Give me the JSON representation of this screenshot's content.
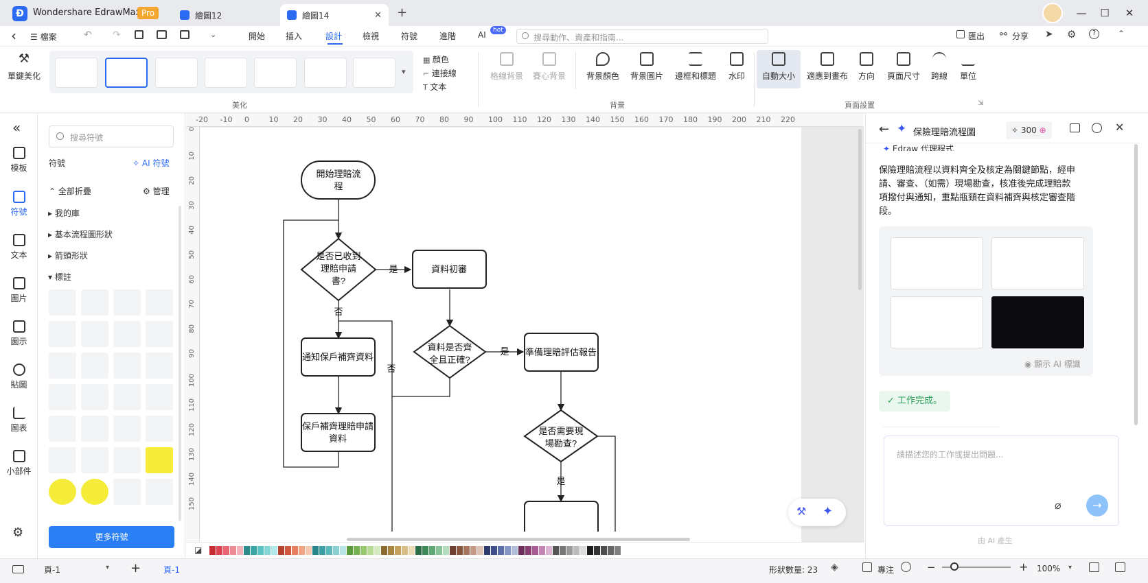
{
  "titlebar": {
    "app_name": "Wondershare EdrawMax",
    "badge": "Pro",
    "tabs": [
      {
        "label": "繪圖12"
      },
      {
        "label": "繪圖14"
      }
    ],
    "new_tab": "+",
    "window_controls": {
      "minimize": "—",
      "maximize": "☐",
      "close": "✕"
    }
  },
  "menubar": {
    "back": "‹",
    "file": "☰ 檔案",
    "items": [
      "開始",
      "插入",
      "設計",
      "檢視",
      "符號",
      "進階",
      "AI"
    ],
    "active_index": 2,
    "ai_badge": "hot",
    "search_placeholder": "搜尋動作、資產和指南...",
    "export": "匯出",
    "share": "分享"
  },
  "ribbon": {
    "beautify": "單鍵美化",
    "beautify_group": "美化",
    "style_options": [
      "顏色",
      "連接線",
      "文本"
    ],
    "background_buttons": [
      "格線背景",
      "賽心背景",
      "背景顏色",
      "背景圖片",
      "邊框和標題",
      "水印"
    ],
    "background_group": "背景",
    "page_buttons": [
      "自動大小",
      "適應到畫布",
      "方向",
      "頁面尺寸",
      "跨線",
      "單位"
    ],
    "page_group": "頁面設置"
  },
  "rail": {
    "collapse": "«",
    "items": [
      "模板",
      "符號",
      "文本",
      "圖片",
      "圖示",
      "貼圖",
      "圖表",
      "小部件"
    ],
    "active_index": 1
  },
  "symbols": {
    "search_placeholder": "搜尋符號",
    "title": "符號",
    "ai_symbols": "AI 符號",
    "collapse_all": "全部折疊",
    "manage": "管理",
    "tree": [
      "我的庫",
      "基本流程圖形狀",
      "箭頭形狀",
      "標註"
    ],
    "more_button": "更多符號"
  },
  "ruler": {
    "top": [
      "-20",
      "-10",
      "0",
      "10",
      "20",
      "30",
      "40",
      "50",
      "60",
      "70",
      "80",
      "90",
      "100",
      "110",
      "120",
      "130",
      "140",
      "150",
      "160",
      "170",
      "180",
      "190",
      "200",
      "210",
      "220"
    ],
    "left": [
      "0",
      "10",
      "20",
      "30",
      "40",
      "50",
      "60",
      "70",
      "80",
      "90",
      "100",
      "110",
      "120",
      "130",
      "140",
      "150"
    ]
  },
  "flowchart": {
    "start": [
      "開始理賠流",
      "程"
    ],
    "decision1": [
      "是否已收到",
      "理賠申請",
      "書?"
    ],
    "review": "資料初審",
    "notify": "通知保戶補齊資料",
    "resubmit": [
      "保戶補齊理賠申請",
      "資料"
    ],
    "decision2": [
      "資料是否齊",
      "全且正確?"
    ],
    "prepare": "準備理賠評估報告",
    "decision3": [
      "是否需要現",
      "場勘查?"
    ],
    "yes": "是",
    "no": "否"
  },
  "ai_panel": {
    "title": "保險理賠流程圖",
    "credits": "300",
    "agent_label": "Edraw 代理程式",
    "summary": "保險理賠流程以資料齊全及核定為關鍵節點，經申請、審查、（如需）現場勘查，核准後完成理賠款項撥付與通知，重點瓶頸在資料補齊與核定審查階段。",
    "show_ai_label": "顯示 AI 標識",
    "status": "工作完成。",
    "input_placeholder": "請描述您的工作或提出問題...",
    "footer": "由 AI 產生"
  },
  "statusbar": {
    "page_select": "頁-1",
    "add_page": "+",
    "active_page": "頁-1",
    "shape_count": "形狀數量: 23",
    "focus": "專注",
    "zoom": "100%"
  },
  "palette": [
    "#c62d33",
    "#d94450",
    "#e86773",
    "#ee8c95",
    "#f3b2b9",
    "#2e8b8b",
    "#3aa6a6",
    "#5cc2c2",
    "#85d6d6",
    "#b3e8e8",
    "#b3412e",
    "#d05a3f",
    "#e57f5d",
    "#f0a483",
    "#f6c8b0",
    "#27868a",
    "#3b9fa3",
    "#5db8bb",
    "#8ad0d2",
    "#b9e5e6",
    "#5a9a3a",
    "#76b24f",
    "#97c86e",
    "#b8dc96",
    "#d6ecc0",
    "#8a6a2e",
    "#a8843f",
    "#c3a05b",
    "#d9bf87",
    "#ebdbb7",
    "#2c6e45",
    "#3f8a59",
    "#5ea874",
    "#87c497",
    "#b4debf",
    "#6e3f2e",
    "#8a553f",
    "#a8735b",
    "#c49985",
    "#ddc3b6",
    "#2e3b6e",
    "#3f4f8a",
    "#5b6ea8",
    "#8595c4",
    "#b3bedd",
    "#6e2e5a",
    "#8a3f74",
    "#a85b93",
    "#c485b4",
    "#ddb3d4",
    "#555555",
    "#777777",
    "#999999",
    "#bbbbbb",
    "#dddddd",
    "#1a1a1a",
    "#333333",
    "#4d4d4d",
    "#666666",
    "#808080"
  ]
}
